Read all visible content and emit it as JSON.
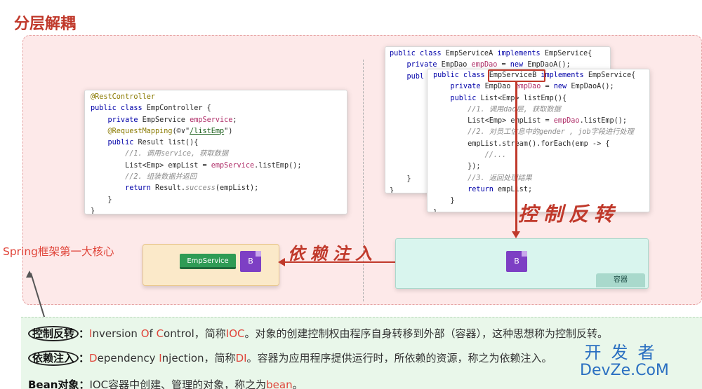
{
  "title": "分层解耦",
  "controller_code": [
    [
      {
        "t": "@RestController",
        "c": "an"
      }
    ],
    [
      {
        "t": "public class ",
        "c": "kw"
      },
      {
        "t": "EmpController {",
        "c": ""
      }
    ],
    [
      {
        "t": "    private ",
        "c": "kw"
      },
      {
        "t": "EmpService ",
        "c": ""
      },
      {
        "t": "empService",
        "c": "fl"
      },
      {
        "t": ";",
        "c": ""
      }
    ],
    [
      {
        "t": "    @RequestMapping",
        "c": "an"
      },
      {
        "t": "(©∨\"",
        "c": ""
      },
      {
        "t": "/listEmp",
        "c": "st"
      },
      {
        "t": "\")",
        "c": ""
      }
    ],
    [
      {
        "t": "    public ",
        "c": "kw"
      },
      {
        "t": "Result list(){",
        "c": ""
      }
    ],
    [
      {
        "t": "        //1. 调用service, 获取数据",
        "c": "cm"
      }
    ],
    [
      {
        "t": "        List<Emp> empList = ",
        "c": ""
      },
      {
        "t": "empService",
        "c": "fl"
      },
      {
        "t": ".listEmp();",
        "c": ""
      }
    ],
    [
      {
        "t": "        //2. 组装数据并返回",
        "c": "cm"
      }
    ],
    [
      {
        "t": "        return ",
        "c": "kw"
      },
      {
        "t": "Result.",
        "c": ""
      },
      {
        "t": "success",
        "c": "cm"
      },
      {
        "t": "(empList);",
        "c": ""
      }
    ],
    [
      {
        "t": "    }",
        "c": ""
      }
    ],
    [
      {
        "t": "}",
        "c": ""
      }
    ]
  ],
  "service_a_code": [
    [
      {
        "t": "public class ",
        "c": "kw"
      },
      {
        "t": "EmpServiceA ",
        "c": ""
      },
      {
        "t": "implements ",
        "c": "kw"
      },
      {
        "t": "EmpService{",
        "c": ""
      }
    ],
    [
      {
        "t": "    private ",
        "c": "kw"
      },
      {
        "t": "EmpDao ",
        "c": ""
      },
      {
        "t": "empDao",
        "c": "fl"
      },
      {
        "t": " = ",
        "c": ""
      },
      {
        "t": "new ",
        "c": "kw"
      },
      {
        "t": "EmpDaoA();",
        "c": ""
      }
    ],
    [
      {
        "t": "    publ",
        "c": "kw"
      }
    ],
    [
      {
        "t": "    ",
        "c": ""
      }
    ],
    [
      {
        "t": "    ",
        "c": ""
      }
    ],
    [
      {
        "t": "    ",
        "c": ""
      }
    ],
    [
      {
        "t": "    ",
        "c": ""
      }
    ],
    [
      {
        "t": "    ",
        "c": ""
      }
    ],
    [
      {
        "t": "    ",
        "c": ""
      }
    ],
    [
      {
        "t": "    ",
        "c": ""
      }
    ],
    [
      {
        "t": "    ",
        "c": ""
      }
    ],
    [
      {
        "t": "    }",
        "c": ""
      }
    ],
    [
      {
        "t": "}",
        "c": ""
      }
    ]
  ],
  "service_b_code": [
    [
      {
        "t": "public class ",
        "c": "kw"
      },
      {
        "t": "EmpServiceB ",
        "c": ""
      },
      {
        "t": "implements ",
        "c": "kw"
      },
      {
        "t": "EmpService{",
        "c": ""
      }
    ],
    [
      {
        "t": "    private ",
        "c": "kw"
      },
      {
        "t": "EmpDao ",
        "c": ""
      },
      {
        "t": "empDao",
        "c": "fl"
      },
      {
        "t": " = ",
        "c": ""
      },
      {
        "t": "new ",
        "c": "kw"
      },
      {
        "t": "EmpDaoA();",
        "c": ""
      }
    ],
    [
      {
        "t": "    public ",
        "c": "kw"
      },
      {
        "t": "List<Emp> listEmp(){",
        "c": ""
      }
    ],
    [
      {
        "t": "        //1. 调用dao层, 获取数据",
        "c": "cm"
      }
    ],
    [
      {
        "t": "        List<Emp> empList = ",
        "c": ""
      },
      {
        "t": "empDao",
        "c": "fl"
      },
      {
        "t": ".listEmp();",
        "c": ""
      }
    ],
    [
      {
        "t": "        //2. 对员工信息中的gender , job字段进行处理",
        "c": "cm"
      }
    ],
    [
      {
        "t": "        empList.stream().forEach(emp -> {",
        "c": ""
      }
    ],
    [
      {
        "t": "            //...",
        "c": "cm"
      }
    ],
    [
      {
        "t": "        });",
        "c": ""
      }
    ],
    [
      {
        "t": "        //3. 返回处理结果",
        "c": "cm"
      }
    ],
    [
      {
        "t": "        return ",
        "c": "kw"
      },
      {
        "t": "empList;",
        "c": ""
      }
    ],
    [
      {
        "t": "    }",
        "c": ""
      }
    ],
    [
      {
        "t": "}",
        "c": ""
      }
    ]
  ],
  "labels": {
    "ioc_hand": "控制反转",
    "di_hand": "依赖注入",
    "empservice_tag": "EmpService",
    "bean_letter": "B",
    "container_tag": "容器",
    "spring_core": "Spring框架第一大核心"
  },
  "definitions": {
    "ioc": {
      "term": "控制反转",
      "colon": "：",
      "parts": [
        {
          "t": "I",
          "red": true
        },
        {
          "t": "nversion ",
          "red": false
        },
        {
          "t": "O",
          "red": true
        },
        {
          "t": "f ",
          "red": false
        },
        {
          "t": "C",
          "red": true
        },
        {
          "t": "ontrol，简称",
          "red": false
        },
        {
          "t": "IOC",
          "red": true
        },
        {
          "t": "。对象的创建控制权由程序自身转移到外部（容器），这种思想称为控制反转。",
          "red": false
        }
      ]
    },
    "di": {
      "term": "依赖注入",
      "colon": "：",
      "parts": [
        {
          "t": "D",
          "red": true
        },
        {
          "t": "ependency ",
          "red": false
        },
        {
          "t": "I",
          "red": true
        },
        {
          "t": "njection，简称",
          "red": false
        },
        {
          "t": "DI",
          "red": true
        },
        {
          "t": "。容器为应用程序提供运行时，所依赖的资源，称之为依赖注入。",
          "red": false
        }
      ]
    },
    "bean": {
      "term": "Bean对象",
      "colon": "：",
      "parts": [
        {
          "t": "IOC容器中创建、管理的对象，称之为",
          "red": false
        },
        {
          "t": "bean",
          "red": true
        },
        {
          "t": "。",
          "red": false
        }
      ]
    }
  },
  "watermark": {
    "cn": "开发者",
    "en": "DevZe.CoM"
  },
  "colors": {
    "accent": "#c0392b",
    "panel": "#fde9e9",
    "defs_bg": "#e9f7ea",
    "container": "#d9f5ee"
  }
}
